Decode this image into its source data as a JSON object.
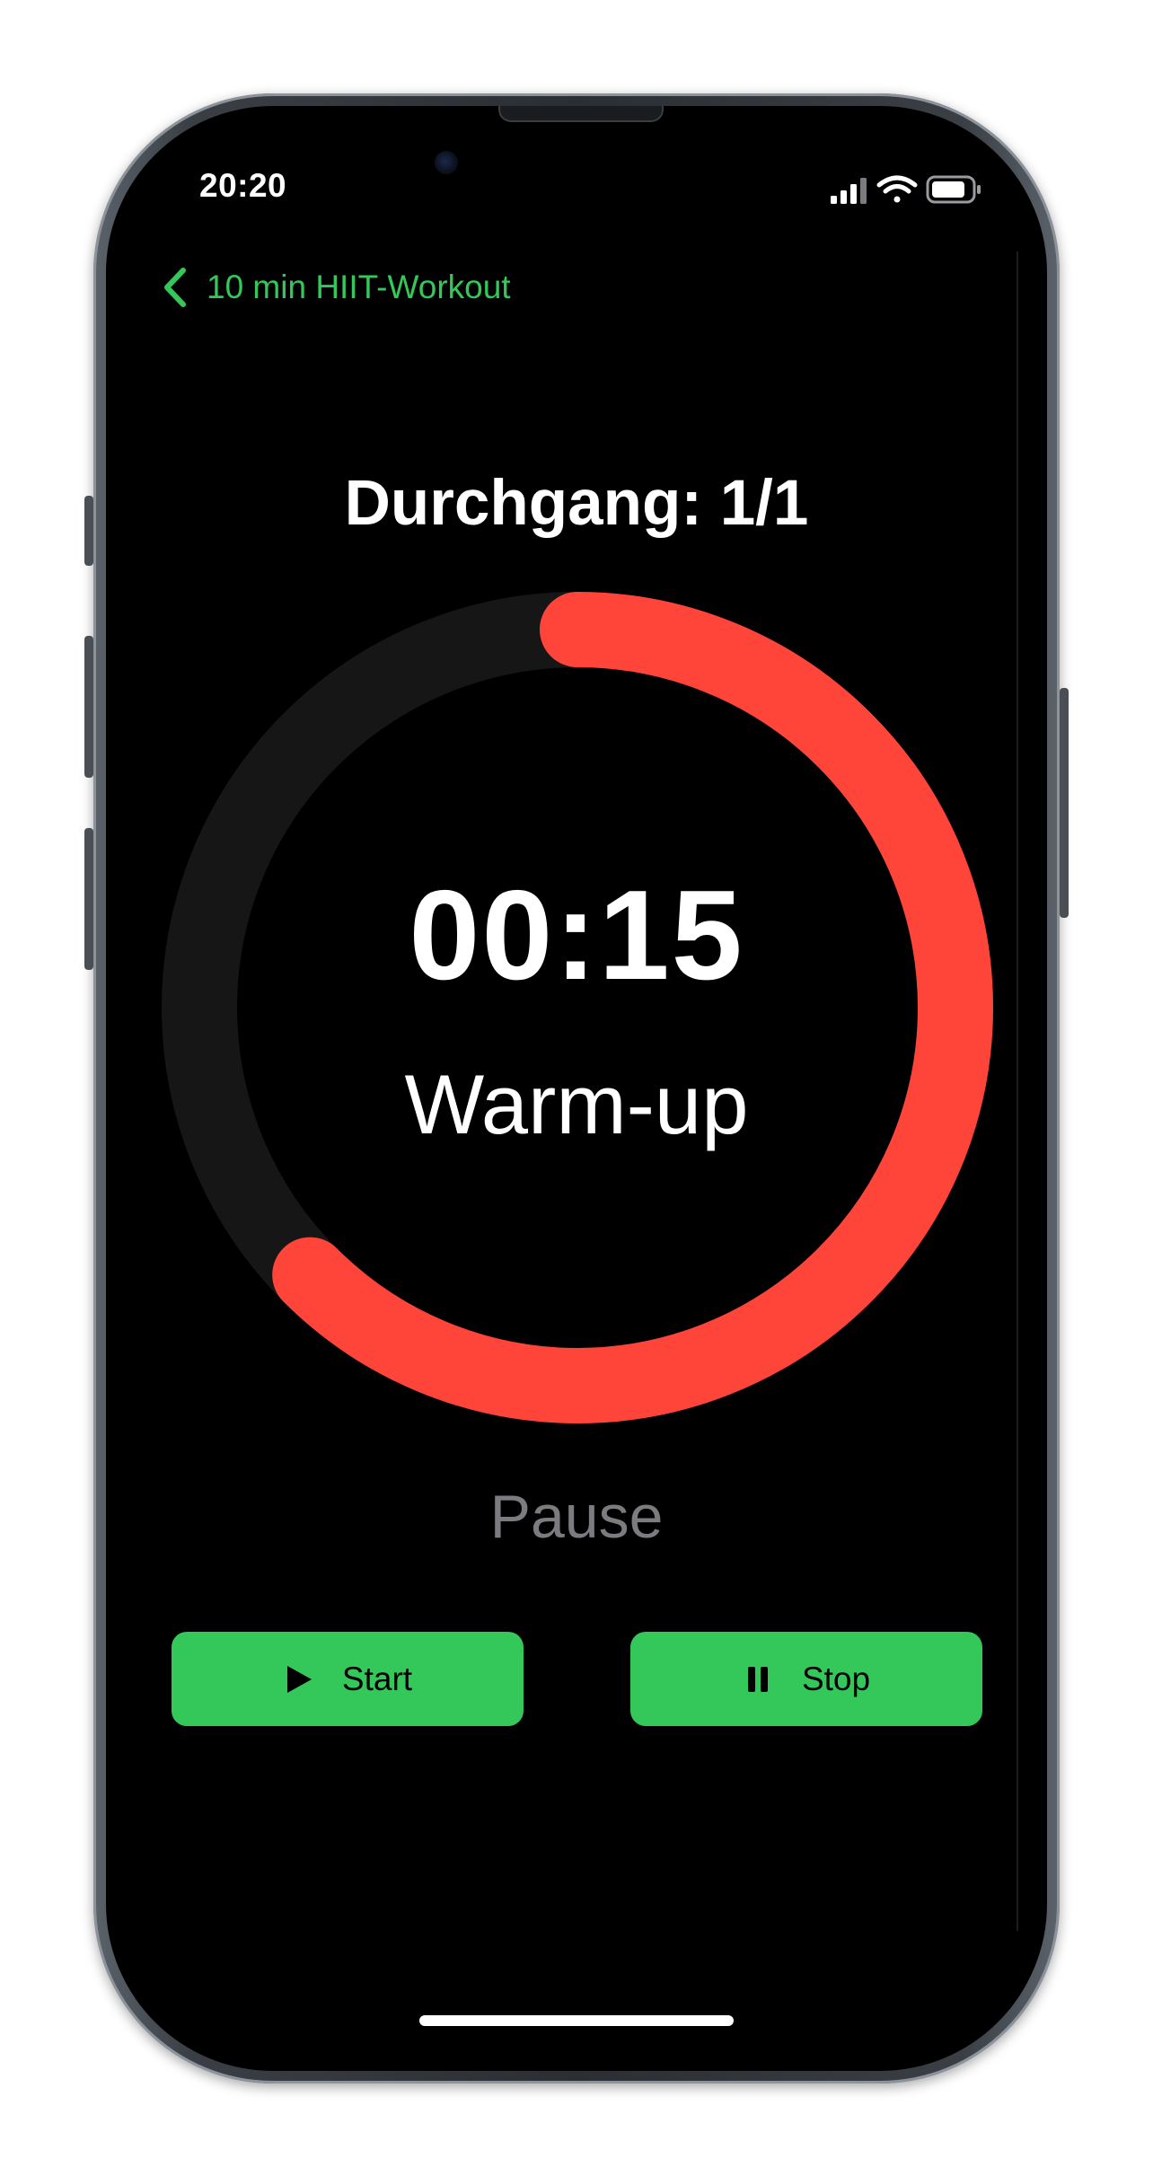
{
  "status_bar": {
    "time": "20:20",
    "signal_icon": "cellular-signal-icon",
    "wifi_icon": "wifi-icon",
    "battery_icon": "battery-icon"
  },
  "nav": {
    "back_icon": "chevron-left-icon",
    "back_label": "10 min HIIT-Workout"
  },
  "workout": {
    "round_label": "Durchgang: 1/1",
    "timer": "00:15",
    "phase": "Warm-up",
    "progress_fraction": 0.625,
    "pause_label": "Pause"
  },
  "controls": {
    "start_label": "Start",
    "start_icon": "play-icon",
    "stop_label": "Stop",
    "stop_icon": "pause-icon"
  },
  "colors": {
    "accent": "#34c759",
    "progress": "#ff453a",
    "track": "#161616",
    "background": "#000000",
    "muted_text": "#7c7c80"
  }
}
